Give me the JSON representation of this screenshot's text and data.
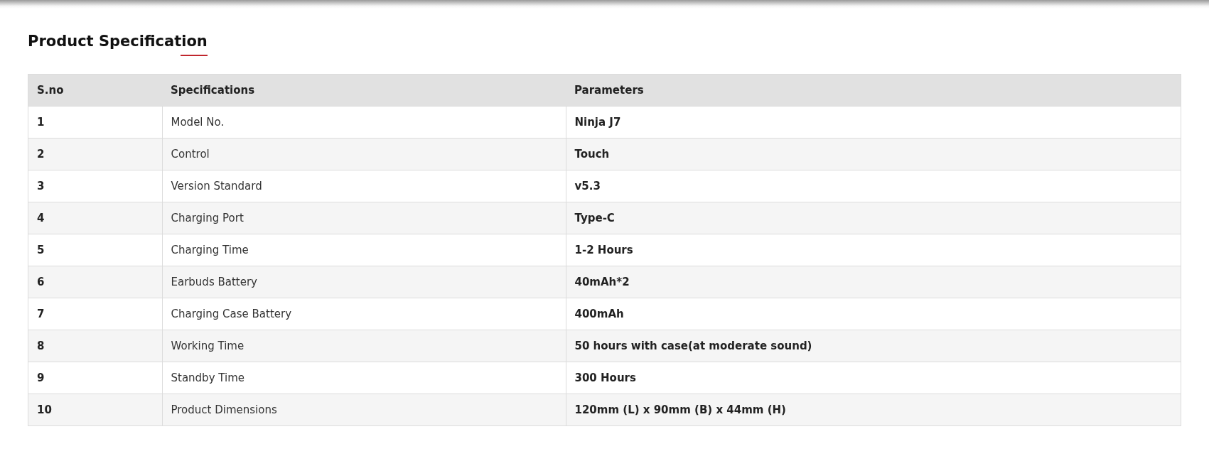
{
  "title": "Product Specification",
  "table": {
    "columns": [
      "S.no",
      "Specifications",
      "Parameters"
    ],
    "rows": [
      {
        "sno": "1",
        "specification": "Model No.",
        "parameter": "Ninja J7"
      },
      {
        "sno": "2",
        "specification": "Control",
        "parameter": "Touch"
      },
      {
        "sno": "3",
        "specification": "Version Standard",
        "parameter": "v5.3"
      },
      {
        "sno": "4",
        "specification": "Charging Port",
        "parameter": "Type-C"
      },
      {
        "sno": "5",
        "specification": "Charging Time",
        "parameter": "1-2 Hours"
      },
      {
        "sno": "6",
        "specification": "Earbuds Battery",
        "parameter": "40mAh*2"
      },
      {
        "sno": "7",
        "specification": "Charging Case Battery",
        "parameter": "400mAh"
      },
      {
        "sno": "8",
        "specification": "Working Time",
        "parameter": "50 hours with case(at moderate sound)"
      },
      {
        "sno": "9",
        "specification": "Standby Time",
        "parameter": "300 Hours"
      },
      {
        "sno": "10",
        "specification": "Product Dimensions",
        "parameter": "120mm (L) x 90mm (B) x 44mm (H)"
      }
    ]
  }
}
